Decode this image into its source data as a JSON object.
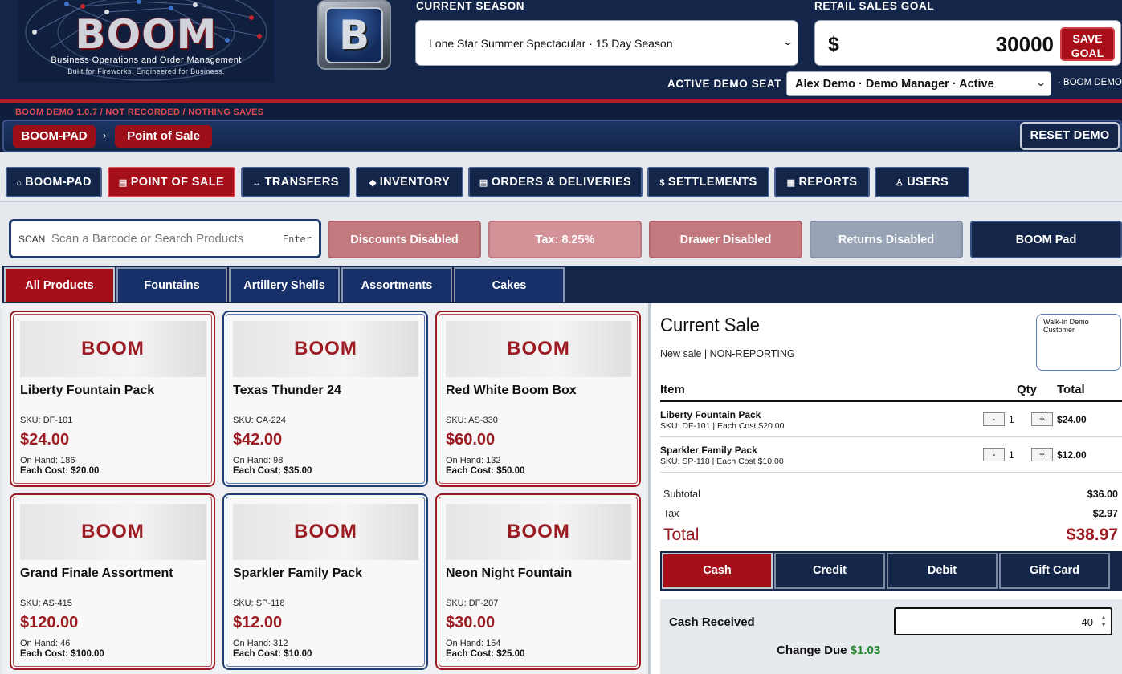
{
  "header": {
    "logo_word": "BOOM",
    "logo_subtitle": "Business Operations and Order Management",
    "logo_tagline": "Built for Fireworks. Engineered for Business.",
    "badge_letter": "B",
    "season_label": "CURRENT SEASON",
    "season_value": "Lone Star Summer Spectacular · 15 Day Season",
    "goal_label": "RETAIL SALES GOAL",
    "goal_currency": "$",
    "goal_value": "30000",
    "save_goal_line1": "SAVE",
    "save_goal_line2": "GOAL",
    "seat_label": "ACTIVE DEMO SEAT",
    "seat_value": "Alex Demo · Demo Manager · Active",
    "app_tag": "· BOOM DEMO"
  },
  "demo_note": "BOOM DEMO 1.0.7 / NOT RECORDED / NOTHING SAVES",
  "breadcrumb": {
    "items": [
      "BOOM-PAD",
      "Point of Sale"
    ],
    "separator": "›"
  },
  "reset_label": "RESET DEMO",
  "nav": {
    "items": [
      {
        "label": "BOOM-PAD",
        "icon": "⌂",
        "icon_name": "home-icon"
      },
      {
        "label": "POINT OF SALE",
        "icon": "▤",
        "icon_name": "register-icon"
      },
      {
        "label": "TRANSFERS",
        "icon": "↔",
        "icon_name": "transfer-icon"
      },
      {
        "label": "INVENTORY",
        "icon": "◆",
        "icon_name": "inventory-icon"
      },
      {
        "label": "ORDERS & DELIVERIES",
        "icon": "▤",
        "icon_name": "orders-icon"
      },
      {
        "label": "SETTLEMENTS",
        "icon": "$",
        "icon_name": "dollar-icon"
      },
      {
        "label": "REPORTS",
        "icon": "▦",
        "icon_name": "reports-icon"
      },
      {
        "label": "USERS",
        "icon": "♙",
        "icon_name": "user-icon"
      }
    ],
    "active_index": 1
  },
  "search": {
    "label": "SCAN",
    "placeholder": "Scan a Barcode or Search Products",
    "enter_hint": "Enter"
  },
  "toggles": {
    "discounts": "Discounts Disabled",
    "tax": "Tax: 8.25%",
    "drawer": "Drawer Disabled",
    "returns": "Returns Disabled",
    "boom_pad": "BOOM Pad"
  },
  "categories": {
    "items": [
      "All Products",
      "Fountains",
      "Artillery Shells",
      "Assortments",
      "Cakes"
    ],
    "active_index": 0
  },
  "products": [
    {
      "image_text": "BOOM",
      "name": "Liberty Fountain Pack",
      "sku": "SKU: DF-101",
      "price": "$24.00",
      "on_hand": "On Hand: 186",
      "each_cost": "Each Cost: $20.00"
    },
    {
      "image_text": "BOOM",
      "name": "Texas Thunder 24",
      "sku": "SKU: CA-224",
      "price": "$42.00",
      "on_hand": "On Hand: 98",
      "each_cost": "Each Cost: $35.00"
    },
    {
      "image_text": "BOOM",
      "name": "Red White Boom Box",
      "sku": "SKU: AS-330",
      "price": "$60.00",
      "on_hand": "On Hand: 132",
      "each_cost": "Each Cost: $50.00"
    },
    {
      "image_text": "BOOM",
      "name": "Grand Finale Assortment",
      "sku": "SKU: AS-415",
      "price": "$120.00",
      "on_hand": "On Hand: 46",
      "each_cost": "Each Cost: $100.00"
    },
    {
      "image_text": "BOOM",
      "name": "Sparkler Family Pack",
      "sku": "SKU: SP-118",
      "price": "$12.00",
      "on_hand": "On Hand: 312",
      "each_cost": "Each Cost: $10.00"
    },
    {
      "image_text": "BOOM",
      "name": "Neon Night Fountain",
      "sku": "SKU: DF-207",
      "price": "$30.00",
      "on_hand": "On Hand: 154",
      "each_cost": "Each Cost: $25.00"
    }
  ],
  "sale": {
    "title": "Current Sale",
    "subtitle": "New sale | NON-REPORTING",
    "customer": "Walk-In Demo Customer",
    "columns": {
      "item": "Item",
      "qty": "Qty",
      "total": "Total"
    },
    "items": [
      {
        "name": "Liberty Fountain Pack",
        "meta": "SKU: DF-101 | Each Cost $20.00",
        "qty": "1",
        "total": "$24.00"
      },
      {
        "name": "Sparkler Family Pack",
        "meta": "SKU: SP-118 | Each Cost $10.00",
        "qty": "1",
        "total": "$12.00"
      }
    ],
    "minus": "-",
    "plus": "+",
    "subtotal_label": "Subtotal",
    "subtotal": "$36.00",
    "tax_label": "Tax",
    "tax": "$2.97",
    "total_label": "Total",
    "total": "$38.97",
    "payment_methods": [
      "Cash",
      "Credit",
      "Debit",
      "Gift Card"
    ],
    "active_payment": 0,
    "cash_received_label": "Cash Received",
    "cash_received": "40",
    "change_due_label": "Change Due",
    "change_due": "$1.03"
  },
  "colors": {
    "navy": "#13264a",
    "brand_red": "#a50f19",
    "price_red": "#9c1a22",
    "change_green": "#218a2a"
  }
}
